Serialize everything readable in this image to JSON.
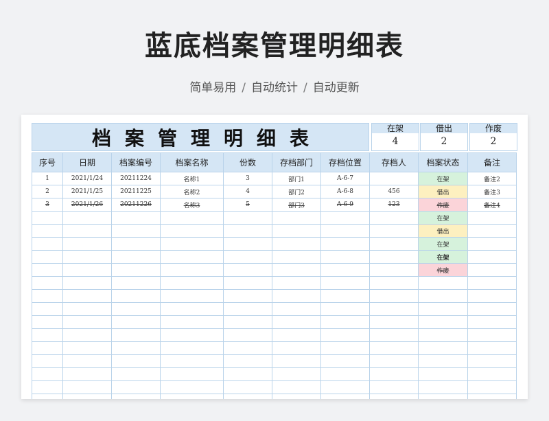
{
  "page": {
    "title": "蓝底档案管理明细表",
    "subtitle": {
      "part1": "简单易用",
      "part2": "自动统计",
      "part3": "自动更新",
      "separator": "/"
    }
  },
  "sheet": {
    "title": "档案管理明细表",
    "stats": [
      {
        "label": "在架",
        "value": "4"
      },
      {
        "label": "借出",
        "value": "2"
      },
      {
        "label": "作废",
        "value": "2"
      }
    ],
    "columns": [
      "序号",
      "日期",
      "档案编号",
      "档案名称",
      "份数",
      "存档部门",
      "存档位置",
      "存档人",
      "档案状态",
      "备注"
    ],
    "rows": [
      {
        "cells": [
          "1",
          "2021/1/24",
          "20211224",
          "名称1",
          "3",
          "部门1",
          "A-6-7",
          "",
          "在架",
          "备注2"
        ]
      },
      {
        "cells": [
          "2",
          "2021/1/25",
          "20211225",
          "名称2",
          "4",
          "部门2",
          "A-6-8",
          "456",
          "借出",
          "备注3"
        ]
      },
      {
        "cells": [
          "3",
          "2021/1/26",
          "20211226",
          "名称3",
          "5",
          "部门3",
          "A-6-9",
          "123",
          "作废",
          "备注4"
        ]
      },
      {
        "cells": [
          "",
          "",
          "",
          "",
          "",
          "",
          "",
          "",
          "在架",
          ""
        ]
      },
      {
        "cells": [
          "",
          "",
          "",
          "",
          "",
          "",
          "",
          "",
          "借出",
          ""
        ]
      },
      {
        "cells": [
          "",
          "",
          "",
          "",
          "",
          "",
          "",
          "",
          "在架",
          ""
        ]
      },
      {
        "cells": [
          "",
          "",
          "",
          "",
          "",
          "",
          "",
          "",
          "在架",
          ""
        ]
      },
      {
        "cells": [
          "",
          "",
          "",
          "",
          "",
          "",
          "",
          "",
          "作废",
          ""
        ]
      },
      {
        "cells": [
          "",
          "",
          "",
          "",
          "",
          "",
          "",
          "",
          "",
          ""
        ]
      },
      {
        "cells": [
          "",
          "",
          "",
          "",
          "",
          "",
          "",
          "",
          "",
          ""
        ]
      },
      {
        "cells": [
          "",
          "",
          "",
          "",
          "",
          "",
          "",
          "",
          "",
          ""
        ]
      },
      {
        "cells": [
          "",
          "",
          "",
          "",
          "",
          "",
          "",
          "",
          "",
          ""
        ]
      },
      {
        "cells": [
          "",
          "",
          "",
          "",
          "",
          "",
          "",
          "",
          "",
          ""
        ]
      },
      {
        "cells": [
          "",
          "",
          "",
          "",
          "",
          "",
          "",
          "",
          "",
          ""
        ]
      },
      {
        "cells": [
          "",
          "",
          "",
          "",
          "",
          "",
          "",
          "",
          "",
          ""
        ]
      },
      {
        "cells": [
          "",
          "",
          "",
          "",
          "",
          "",
          "",
          "",
          "",
          ""
        ]
      },
      {
        "cells": [
          "",
          "",
          "",
          "",
          "",
          "",
          "",
          "",
          "",
          ""
        ]
      },
      {
        "cells": [
          "",
          "",
          "",
          "",
          "",
          "",
          "",
          "",
          "",
          ""
        ]
      }
    ]
  },
  "colors": {
    "header_bg": "#d5e6f5",
    "border": "#b9d3ea",
    "status_on_bg": "#d6f2dc",
    "status_out_bg": "#fdf0c0",
    "status_void_bg": "#fbd4d9"
  }
}
